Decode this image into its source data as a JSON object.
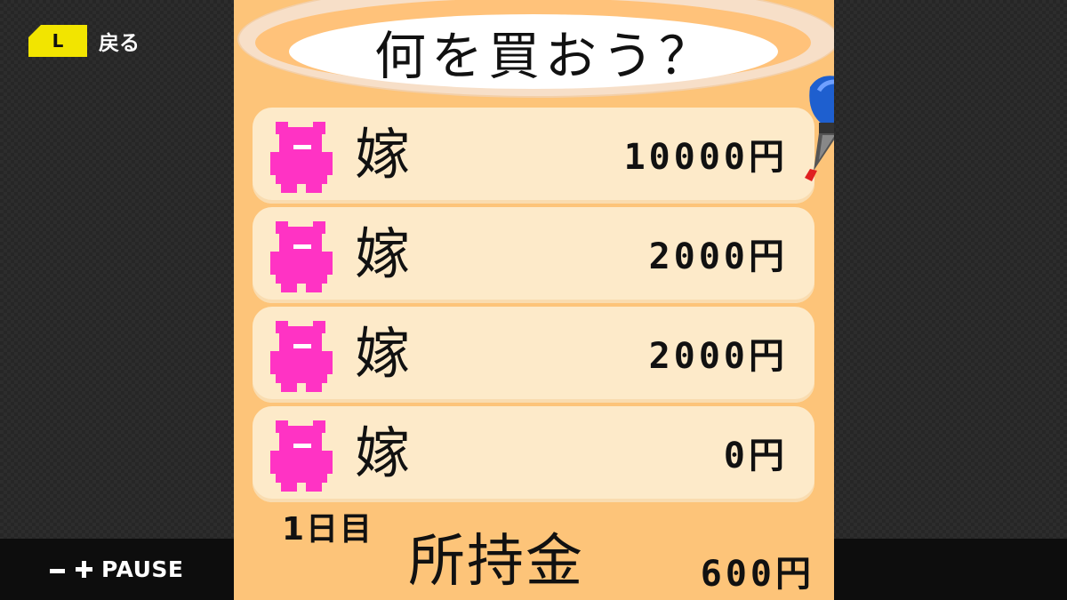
{
  "back_hint": {
    "button": "L",
    "label": "戻る"
  },
  "pause": {
    "label": "PAUSE"
  },
  "screen": {
    "title": "何を買おう？",
    "items": [
      {
        "name": "嫁",
        "price": "10000円",
        "icon": "pink-bear-icon"
      },
      {
        "name": "嫁",
        "price": "2000円",
        "icon": "pink-bear-icon"
      },
      {
        "name": "嫁",
        "price": "2000円",
        "icon": "pink-bear-icon"
      },
      {
        "name": "嫁",
        "price": "0円",
        "icon": "pink-bear-icon"
      }
    ],
    "day": "1日目",
    "money_label": "所持金",
    "money_value": "600円",
    "selected_index": 0
  },
  "colors": {
    "screen_bg": "#fdc479",
    "row_bg": "#fdeac9",
    "bear": "#ff33c4",
    "l_button": "#f2e500",
    "pen_cap": "#1e5fcf"
  }
}
